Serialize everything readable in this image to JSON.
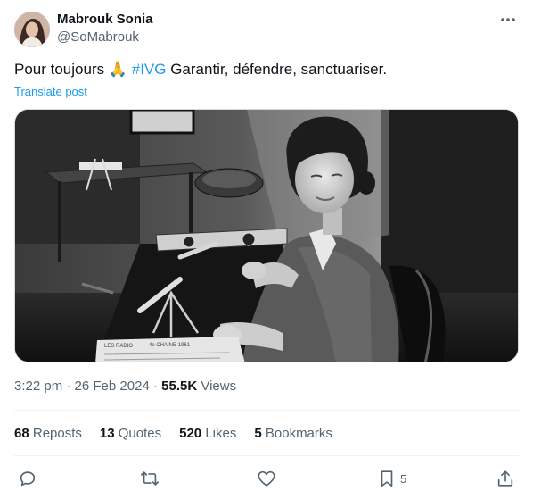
{
  "author": {
    "display_name": "Mabrouk Sonia",
    "handle": "@SoMabrouk"
  },
  "tweet": {
    "text_before": "Pour toujours 🙏 ",
    "hashtag": "#IVG",
    "text_after": " Garantir, défendre, sanctuariser.",
    "translate_label": "Translate post"
  },
  "media": {
    "print_line_1": "LES RADIO",
    "print_line_2": "4e CHAINE 1961"
  },
  "meta": {
    "time": "3:22 pm",
    "separator": "·",
    "date": "26 Feb 2024",
    "views_count": "55.5K",
    "views_label": "Views"
  },
  "stats": {
    "reposts_count": "68",
    "reposts_label": "Reposts",
    "quotes_count": "13",
    "quotes_label": "Quotes",
    "likes_count": "520",
    "likes_label": "Likes",
    "bookmarks_count": "5",
    "bookmarks_label": "Bookmarks"
  },
  "actions": {
    "bookmark_count": "5"
  },
  "colors": {
    "accent": "#1d9bf0",
    "text_primary": "#0f1419",
    "text_secondary": "#536471",
    "divider": "#eff3f4"
  },
  "icons": [
    "more-icon",
    "reply-icon",
    "repost-icon",
    "like-icon",
    "bookmark-icon",
    "share-icon"
  ]
}
